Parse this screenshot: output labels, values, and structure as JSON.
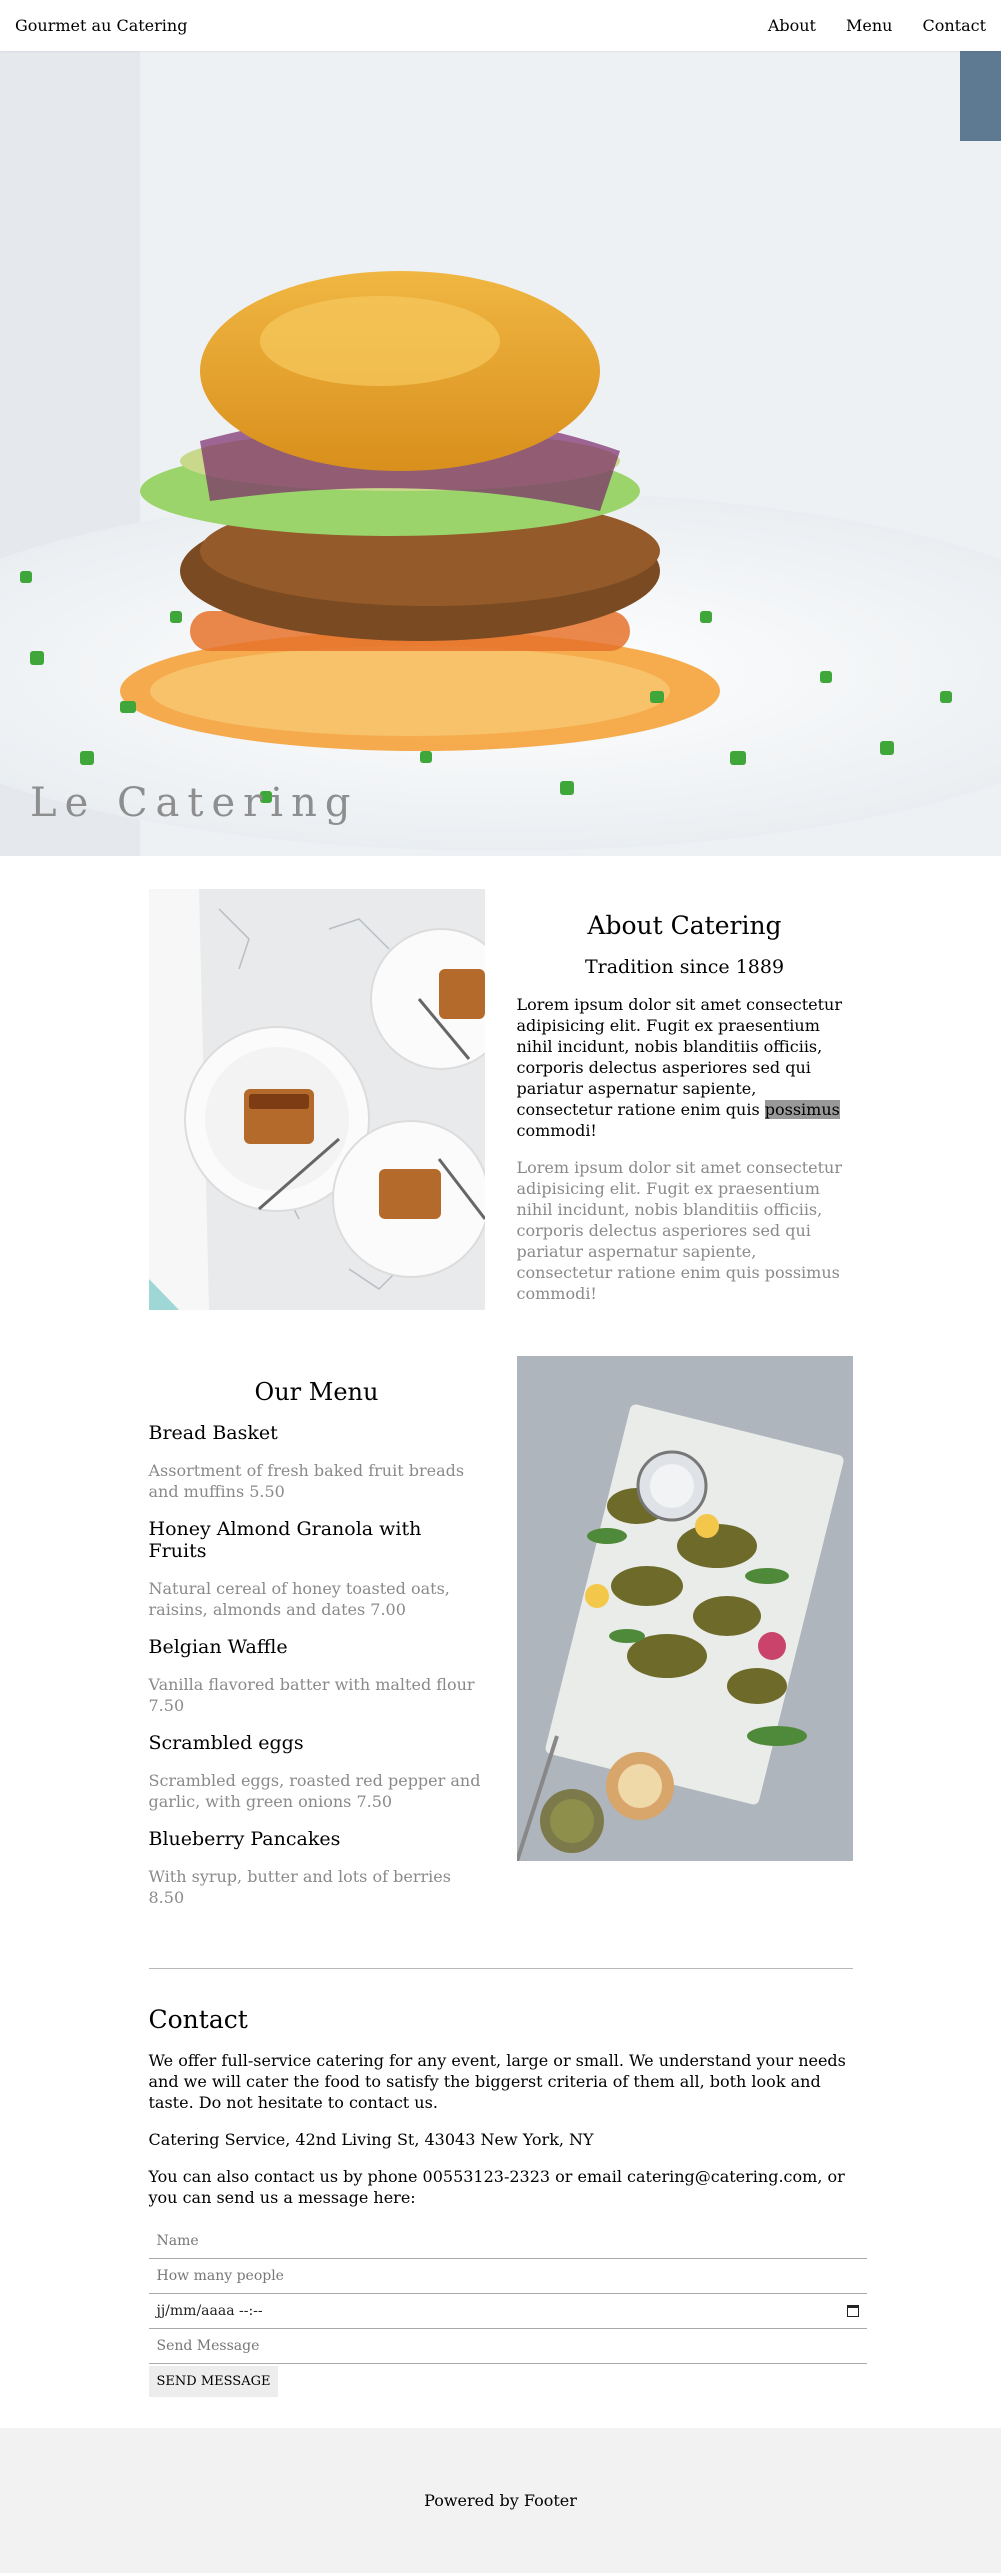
{
  "header": {
    "site_title": "Gourmet au Catering",
    "nav": [
      "About",
      "Menu",
      "Contact"
    ]
  },
  "hero": {
    "title": "Le Catering"
  },
  "about": {
    "heading": "About Catering",
    "subheading": "Tradition since 1889",
    "p1_before": "Lorem ipsum dolor sit amet consectetur adipisicing elit. Fugit ex praesentium nihil incidunt, nobis blanditiis officiis, corporis delectus asperiores sed qui pariatur aspernatur sapiente, consectetur ratione enim quis ",
    "p1_highlight": "possimus",
    "p1_after": " commodi!",
    "p2": "Lorem ipsum dolor sit amet consectetur adipisicing elit. Fugit ex praesentium nihil incidunt, nobis blanditiis officiis, corporis delectus asperiores sed qui pariatur aspernatur sapiente, consectetur ratione enim quis possimus commodi!"
  },
  "menu": {
    "heading": "Our Menu",
    "items": [
      {
        "name": "Bread Basket",
        "desc": "Assortment of fresh baked fruit breads and muffins 5.50"
      },
      {
        "name": "Honey Almond Granola with Fruits",
        "desc": "Natural cereal of honey toasted oats, raisins, almonds and dates 7.00"
      },
      {
        "name": "Belgian Waffle",
        "desc": "Vanilla flavored batter with malted flour 7.50"
      },
      {
        "name": "Scrambled eggs",
        "desc": "Scrambled eggs, roasted red pepper and garlic, with green onions 7.50"
      },
      {
        "name": "Blueberry Pancakes",
        "desc": "With syrup, butter and lots of berries 8.50"
      }
    ]
  },
  "contact": {
    "heading": "Contact",
    "p1": "We offer full-service catering for any event, large or small. We understand your needs and we will cater the food to satisfy the biggerst criteria of them all, both look and taste. Do not hesitate to contact us.",
    "p2": "Catering Service, 42nd Living St, 43043 New York, NY",
    "p3": "You can also contact us by phone 00553123-2323 or email catering@catering.com, or you can send us a message here:",
    "name_placeholder": "Name",
    "people_placeholder": "How many people",
    "date_placeholder": "jj/mm/aaaa --:--",
    "message_placeholder": "Send Message",
    "send_label": "SEND MESSAGE"
  },
  "footer": {
    "text": "Powered by Footer"
  }
}
